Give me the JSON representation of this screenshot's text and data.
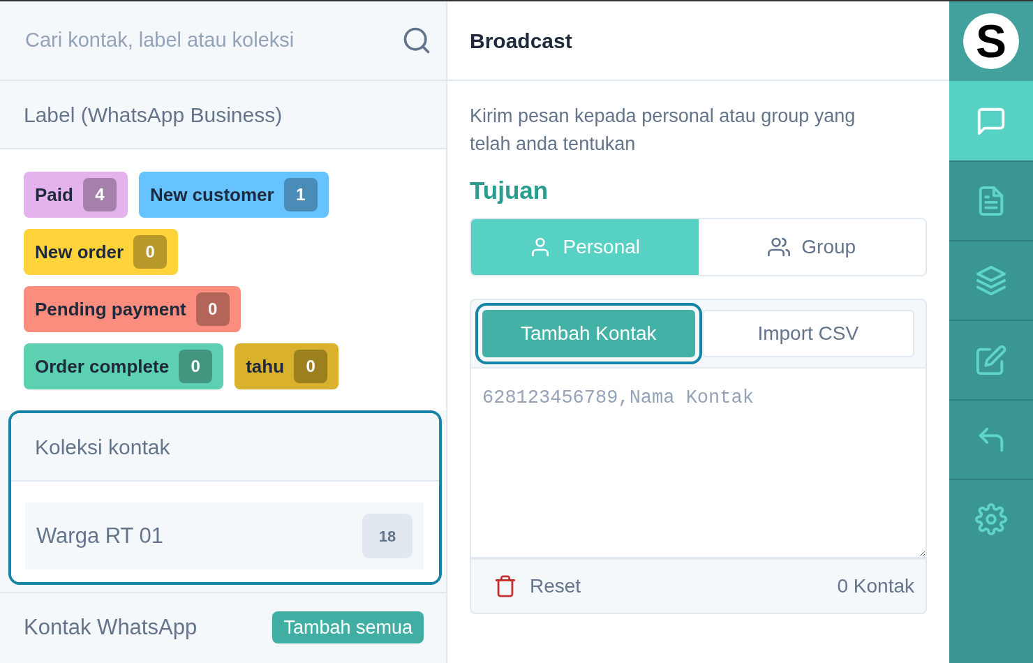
{
  "contacts_panel": {
    "search": {
      "placeholder": "Cari kontak, label atau koleksi"
    },
    "label_section": {
      "title": "Label (WhatsApp Business)",
      "labels": [
        {
          "name": "Paid",
          "count": "4",
          "color": "#e4b3ee"
        },
        {
          "name": "New customer",
          "count": "1",
          "color": "#66c3ff"
        },
        {
          "name": "New order",
          "count": "0",
          "color": "#ffd43b"
        },
        {
          "name": "Pending payment",
          "count": "0",
          "color": "#fa8d7e"
        },
        {
          "name": "Order complete",
          "count": "0",
          "color": "#5cd0b0"
        },
        {
          "name": "tahu",
          "count": "0",
          "color": "#d9b12c"
        }
      ]
    },
    "collection_section": {
      "title": "Koleksi kontak",
      "highlighted": true,
      "items": [
        {
          "name": "Warga RT 01",
          "count": "18"
        }
      ]
    },
    "whatsapp_section": {
      "title": "Kontak WhatsApp",
      "action": "Tambah semua"
    }
  },
  "broadcast": {
    "title": "Broadcast",
    "description": "Kirim pesan kepada personal atau group yang telah anda tentukan",
    "target_heading": "Tujuan",
    "target_tabs": [
      {
        "kind": "person",
        "label": "Personal",
        "selected": true
      },
      {
        "kind": "people",
        "label": "Group",
        "selected": false
      }
    ],
    "input_tabs": [
      {
        "label": "Tambah Kontak",
        "selected": true,
        "highlighted": true
      },
      {
        "label": "Import CSV",
        "selected": false,
        "highlighted": false
      }
    ],
    "contacts_input": {
      "placeholder": "628123456789,Nama Kontak"
    },
    "reset": "Reset",
    "contact_count": "0 Kontak"
  },
  "sidebar": {
    "logo": "S",
    "items": [
      {
        "kind": "chat",
        "selected": true
      },
      {
        "kind": "document",
        "selected": false
      },
      {
        "kind": "layers",
        "selected": false
      },
      {
        "kind": "edit",
        "selected": false
      },
      {
        "kind": "reply",
        "selected": false
      },
      {
        "kind": "settings",
        "selected": false
      }
    ]
  }
}
